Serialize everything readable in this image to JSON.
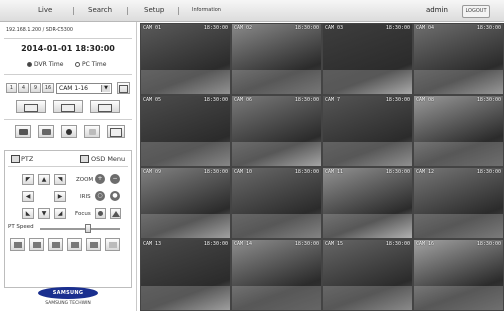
{
  "nav": {
    "live": "Live",
    "search": "Search",
    "setup": "Setup",
    "information": "Information",
    "separator": "|"
  },
  "user": {
    "name": "admin",
    "logout": "LOGOUT"
  },
  "sidebar": {
    "ip": "192.168.1.200 / SDR-C5300",
    "datetime": "2014-01-01 18:30:00",
    "dvr_time": "DVR Time",
    "pc_time": "PC Time",
    "time_mode": "DVR Time",
    "split_buttons": [
      "1",
      "4",
      "9",
      "16"
    ],
    "channel_select": "CAM 1-16",
    "ptz_tab": "PTZ",
    "osd_tab": "OSD Menu",
    "zoom_label": "ZOOM",
    "iris_label": "IRIS",
    "focus_label": "Focus",
    "pt_speed_label": "PT Speed",
    "pt_speed": 0.6,
    "logo_text": "SAMSUNG",
    "logo_sub": "SAMSUNG TECHWIN"
  },
  "cameras": [
    {
      "label": "CAM 01",
      "time": "18:30:00"
    },
    {
      "label": "CAM 02",
      "time": "18:30:00"
    },
    {
      "label": "CAM 03",
      "time": "18:30:00"
    },
    {
      "label": "CAM 04",
      "time": "18:30:00"
    },
    {
      "label": "CAM 05",
      "time": "18:30:00"
    },
    {
      "label": "CAM 06",
      "time": "18:30:00"
    },
    {
      "label": "CAM 7",
      "time": "18:30:00"
    },
    {
      "label": "CAM 08",
      "time": "18:30:00"
    },
    {
      "label": "CAM 09",
      "time": "18:30:00"
    },
    {
      "label": "CAM 10",
      "time": "18:30:00"
    },
    {
      "label": "CAM 11",
      "time": "18:30:00"
    },
    {
      "label": "CAM 12",
      "time": "18:30:00"
    },
    {
      "label": "CAM 13",
      "time": "18:30:00"
    },
    {
      "label": "CAM 14",
      "time": "18:30:00"
    },
    {
      "label": "CAM 15",
      "time": "18:30:00"
    },
    {
      "label": "CAM 16",
      "time": "18:30:00"
    }
  ]
}
